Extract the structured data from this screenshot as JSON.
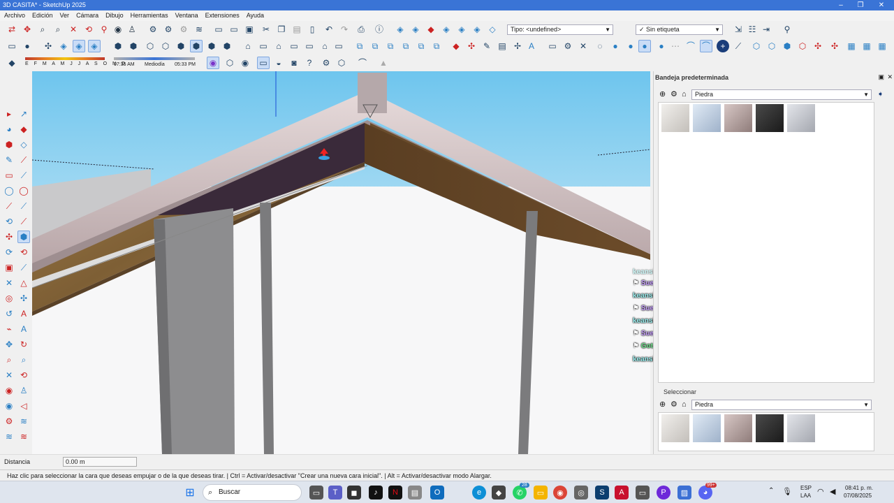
{
  "window": {
    "title": "3D CASITA* - SketchUp 2025"
  },
  "menu": [
    "Archivo",
    "Edición",
    "Ver",
    "Cámara",
    "Dibujo",
    "Herramientas",
    "Ventana",
    "Extensiones",
    "Ayuda"
  ],
  "toolbar": {
    "tag_dropdown": "Tipo: <undefined>",
    "tag_check": "✓ Sin etiqueta",
    "shadow_months": "E F M A M J J A S O N D",
    "shadow_time_start": "07:35 AM",
    "shadow_mid": "Mediodía",
    "shadow_time_end": "05:33 PM"
  },
  "panel": {
    "title": "Bandeja predeterminada",
    "material_top": "Piedra",
    "select_tab": "Seleccionar",
    "material_bottom": "Piedra",
    "swatch_colors": [
      "#dcdad6",
      "#c9d6e6",
      "#b9a9a6",
      "#2c2c2c",
      "#c7c9cf"
    ]
  },
  "chat": [
    {
      "user": "keansito",
      "msg": ": Xddd"
    },
    {
      "user": "Suei",
      "msg": ":"
    },
    {
      "user": "keansito",
      "msg": ": asi te va a hablar primo?"
    },
    {
      "user": "Suei",
      "msg": ": en verlo ps"
    },
    {
      "user": "keansito",
      "msg": ": si ps iglesia"
    },
    {
      "user": "Suei",
      "msg": ": de pasada"
    },
    {
      "user": "Gotzar",
      "msg": ": xd"
    },
    {
      "user": "keansito",
      "msg": ": ese es perro no se enamora"
    }
  ],
  "distance": {
    "label": "Distancia",
    "value": "0.00 m"
  },
  "status": "Haz clic para seleccionar la cara que deseas empujar o de la que deseas tirar. | Ctrl = Activar/desactivar \"Crear una nueva cara inicial\". | Alt = Activar/desactivar modo Alargar.",
  "taskbar": {
    "search": "Buscar",
    "lang1": "ESP",
    "lang2": "LAA",
    "time": "08:41 p. m.",
    "date": "07/08/2025",
    "badge1": "28",
    "badge2": "99+"
  },
  "colors": {
    "accent": "#3a74d6",
    "wood": "#8a6a3c",
    "tile": "#d7c8c8",
    "sky": "#6cc3ec"
  }
}
